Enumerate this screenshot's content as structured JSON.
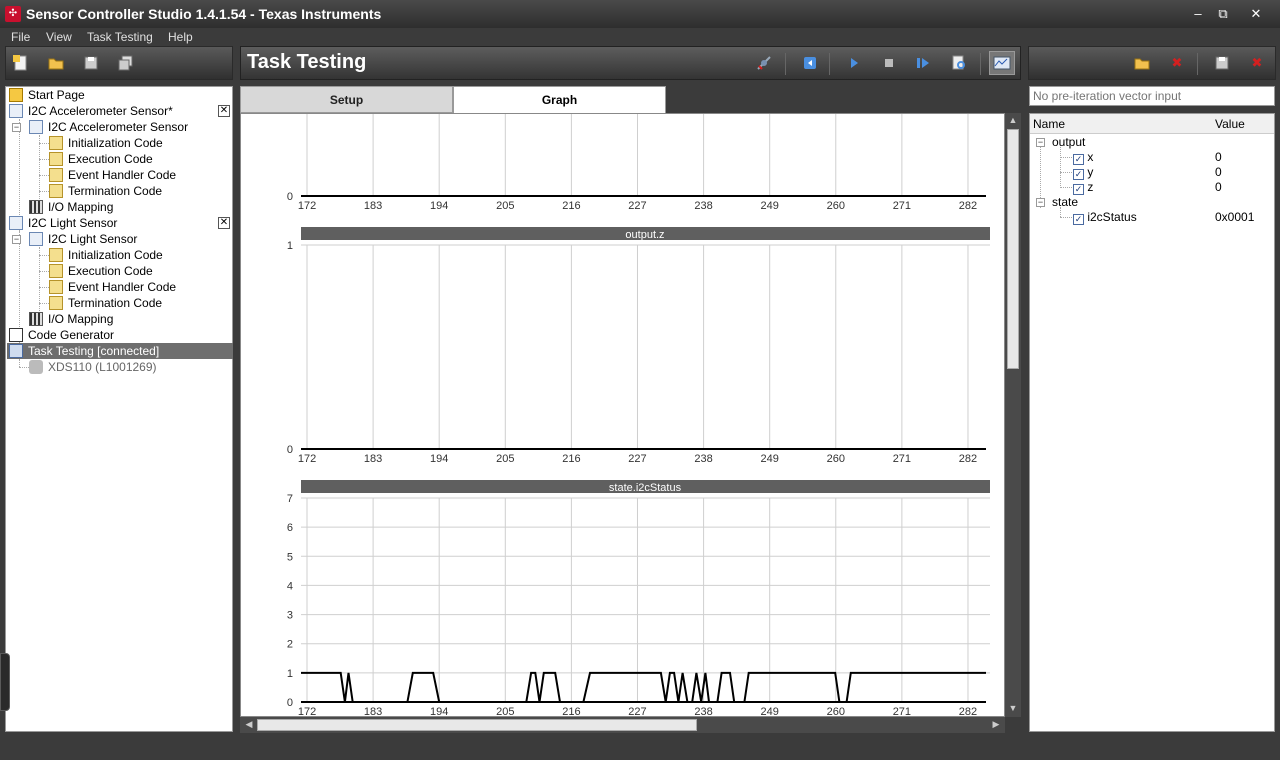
{
  "window": {
    "title": "Sensor Controller Studio 1.4.1.54 - Texas Instruments",
    "minimize": "‒",
    "maximize": "⧉",
    "close": "✕"
  },
  "menu": [
    "File",
    "View",
    "Task Testing",
    "Help"
  ],
  "project_tree": {
    "items": [
      {
        "label": "Start Page"
      },
      {
        "label": "I2C Accelerometer Sensor*"
      },
      {
        "label": "I2C Accelerometer Sensor"
      },
      {
        "label": "Initialization Code"
      },
      {
        "label": "Execution Code"
      },
      {
        "label": "Event Handler Code"
      },
      {
        "label": "Termination Code"
      },
      {
        "label": "I/O Mapping"
      },
      {
        "label": "I2C Light Sensor"
      },
      {
        "label": "I2C Light Sensor"
      },
      {
        "label": "Initialization Code"
      },
      {
        "label": "Execution Code"
      },
      {
        "label": "Event Handler Code"
      },
      {
        "label": "Termination Code"
      },
      {
        "label": "I/O Mapping"
      },
      {
        "label": "Code Generator"
      },
      {
        "label": "Task Testing [connected]"
      },
      {
        "label": "XDS110 (L1001269)"
      }
    ],
    "close_glyph": "✕"
  },
  "page": {
    "title": "Task Testing"
  },
  "tabs": [
    {
      "label": "Setup"
    },
    {
      "label": "Graph"
    }
  ],
  "vector_input": {
    "placeholder": "No pre-iteration vector input"
  },
  "variables": {
    "headers": [
      "Name",
      "Value"
    ],
    "groups": [
      {
        "name": "output",
        "items": [
          {
            "name": "x",
            "value": "0"
          },
          {
            "name": "y",
            "value": "0"
          },
          {
            "name": "z",
            "value": "0"
          }
        ]
      },
      {
        "name": "state",
        "items": [
          {
            "name": "i2cStatus",
            "value": "0x0001"
          }
        ]
      }
    ]
  },
  "colors": {
    "accent": "#4a8fe0",
    "stop_red": "#d42020",
    "panel_dark": "#3b3b3b",
    "plot_title_bg": "#5f5f5f"
  },
  "chart_data": [
    {
      "type": "line",
      "title": "",
      "x": [
        172,
        183,
        194,
        205,
        216,
        227,
        238,
        249,
        260,
        271,
        282
      ],
      "xlim": [
        171,
        285
      ],
      "ylim": [
        0,
        1
      ],
      "yticks": [
        0
      ],
      "grid": true,
      "series": [
        {
          "values": [
            [
              171,
              0
            ],
            [
              285,
              0
            ]
          ]
        }
      ]
    },
    {
      "type": "line",
      "title": "output.z",
      "x": [
        172,
        183,
        194,
        205,
        216,
        227,
        238,
        249,
        260,
        271,
        282
      ],
      "xlim": [
        171,
        285
      ],
      "ylim": [
        0,
        1
      ],
      "yticks": [
        1,
        0
      ],
      "grid": true,
      "series": [
        {
          "values": [
            [
              171,
              0
            ],
            [
              285,
              0
            ]
          ]
        }
      ]
    },
    {
      "type": "line",
      "title": "state.i2cStatus",
      "x": [
        172,
        183,
        194,
        205,
        216,
        227,
        238,
        249,
        260,
        271,
        282
      ],
      "xlim": [
        171,
        285
      ],
      "ylim": [
        0,
        7
      ],
      "yticks": [
        7,
        6,
        5,
        4,
        3,
        2,
        1,
        0
      ],
      "grid": true,
      "series": [
        {
          "values": [
            [
              171,
              1
            ],
            [
              177.6,
              1
            ],
            [
              178.3,
              0
            ],
            [
              178.9,
              1
            ],
            [
              179.6,
              0
            ],
            [
              188.7,
              0
            ],
            [
              189.6,
              1
            ],
            [
              193.0,
              1
            ],
            [
              194.0,
              0
            ],
            [
              208.5,
              0
            ],
            [
              209.3,
              1
            ],
            [
              210.0,
              1
            ],
            [
              210.7,
              0
            ],
            [
              211.4,
              1
            ],
            [
              213.3,
              1
            ],
            [
              214.1,
              0
            ],
            [
              218.0,
              0
            ],
            [
              219.1,
              1
            ],
            [
              230.9,
              1
            ],
            [
              231.7,
              0
            ],
            [
              232.4,
              1
            ],
            [
              233.1,
              1
            ],
            [
              233.8,
              0
            ],
            [
              234.5,
              1
            ],
            [
              235.3,
              0
            ],
            [
              236.1,
              0
            ],
            [
              236.8,
              1
            ],
            [
              237.6,
              0
            ],
            [
              238.3,
              1
            ],
            [
              238.9,
              0
            ],
            [
              240.3,
              0
            ],
            [
              241.0,
              1
            ],
            [
              242.4,
              1
            ],
            [
              243.1,
              0
            ],
            [
              244.8,
              0
            ],
            [
              245.5,
              1
            ],
            [
              259.9,
              1
            ],
            [
              260.6,
              0
            ],
            [
              261.8,
              0
            ],
            [
              262.5,
              1
            ],
            [
              285,
              1
            ]
          ]
        }
      ]
    }
  ]
}
